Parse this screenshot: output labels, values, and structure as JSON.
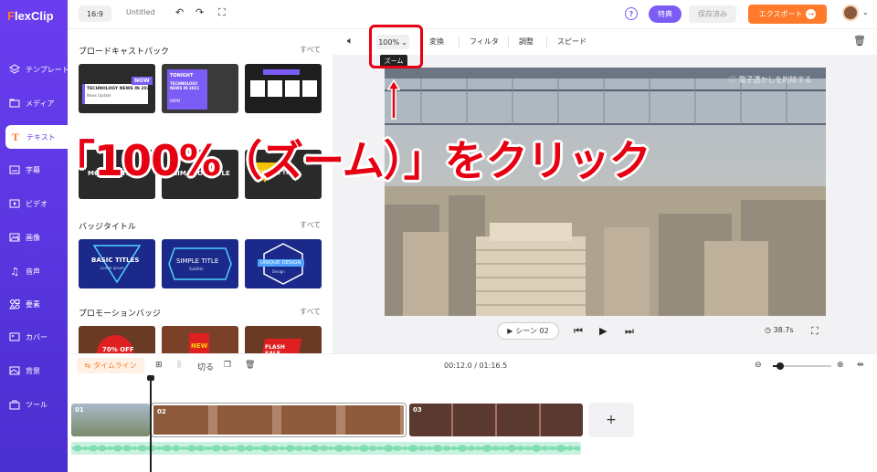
{
  "sidebar": {
    "logo_f": "F",
    "logo_rest": "lexClip",
    "items": [
      {
        "label": "テンプレート",
        "icon": "layers-icon"
      },
      {
        "label": "メディア",
        "icon": "folder-icon"
      },
      {
        "label": "テキスト",
        "icon": "text-icon"
      },
      {
        "label": "字幕",
        "icon": "subtitle-icon"
      },
      {
        "label": "ビデオ",
        "icon": "video-icon"
      },
      {
        "label": "画像",
        "icon": "image-icon"
      },
      {
        "label": "音声",
        "icon": "music-icon"
      },
      {
        "label": "要素",
        "icon": "elements-icon"
      },
      {
        "label": "カバー",
        "icon": "cover-icon"
      },
      {
        "label": "背景",
        "icon": "background-icon"
      },
      {
        "label": "ツール",
        "icon": "toolbox-icon"
      }
    ]
  },
  "topbar": {
    "ratio": "16:9",
    "title": "Untitled",
    "special": "特典",
    "saved": "保存済み",
    "export": "エクスポート"
  },
  "panel": {
    "sections": [
      {
        "title": "ブロードキャストパック",
        "all": "すべて",
        "thumbs": [
          {
            "t1": "NOW",
            "t2": "TECHNOLOGY NEWS IN 2021",
            "t3": "News Update"
          },
          {
            "t1": "TONIGHT",
            "t2": "TECHNOLOGY NEWS IN 2021",
            "t3": "08PM"
          },
          {
            "t1": "",
            "t2": "",
            "t3": ""
          }
        ]
      },
      {
        "title": "エフェクト",
        "all": "",
        "thumbs": [
          {
            "t1": "MODERN TITLE"
          },
          {
            "t1": "ANIMATION TITLE"
          },
          {
            "t1": "SIMPLE TITLE"
          }
        ]
      },
      {
        "title": "バッジタイトル",
        "all": "すべて",
        "thumbs": [
          {
            "t1": "BASIC TITLES",
            "t2": "Lorem ipsum"
          },
          {
            "t1": "SIMPLE TITLE",
            "t2": "Subtitle"
          },
          {
            "t1": "UNIQUE DESIGN",
            "t2": "Design"
          }
        ]
      },
      {
        "title": "プロモーションバッジ",
        "all": "すべて",
        "thumbs": [
          {
            "t1": "70% OFF"
          },
          {
            "t1": "NEW"
          },
          {
            "t1": "FLASH SALE"
          }
        ]
      }
    ]
  },
  "preview": {
    "zoom": "100%",
    "tooltip": "ズーム",
    "tools": [
      "変換",
      "フィルタ",
      "調整",
      "スピード"
    ],
    "watermark": "ⓘ 電子透かしを削除する",
    "scene": "シーン 02",
    "duration": "38.7s"
  },
  "annotation": {
    "text": "「100%（ズーム）」をクリック",
    "color": "#e60012"
  },
  "timeline": {
    "label": "タイムライン",
    "split": "切る",
    "time": "00:12.0 / 01:16.5",
    "clips": [
      {
        "label": "01"
      },
      {
        "label": "02"
      },
      {
        "label": "03"
      }
    ],
    "add": "+"
  },
  "colors": {
    "brand": "#6b3df0",
    "accent": "#ff7a2a",
    "highlight": "#e60012"
  }
}
